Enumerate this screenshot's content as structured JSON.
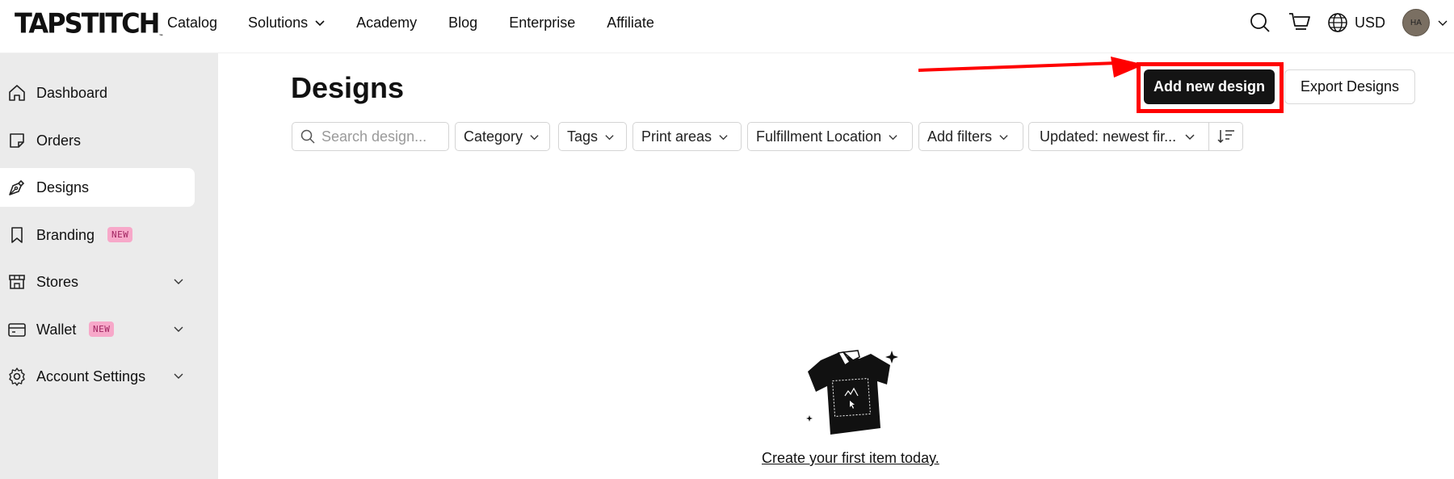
{
  "brand": {
    "logo_text": "TAPSTITCH",
    "logo_tm": "™"
  },
  "topnav": {
    "links": [
      {
        "label": "Catalog"
      },
      {
        "label": "Solutions"
      },
      {
        "label": "Academy"
      },
      {
        "label": "Blog"
      },
      {
        "label": "Enterprise"
      },
      {
        "label": "Affiliate"
      }
    ],
    "currency": "USD",
    "avatar_initials": "HA",
    "icons": [
      "search-icon",
      "cart-icon",
      "globe-icon",
      "chevron-down-icon"
    ]
  },
  "sidebar": {
    "items": [
      {
        "label": "Dashboard",
        "icon": "home-icon"
      },
      {
        "label": "Orders",
        "icon": "sticky-note-icon"
      },
      {
        "label": "Designs",
        "icon": "pen-nib-icon",
        "active": true
      },
      {
        "label": "Branding",
        "icon": "bookmark-icon",
        "badge": "NEW"
      },
      {
        "label": "Stores",
        "icon": "store-icon"
      },
      {
        "label": "Wallet",
        "icon": "wallet-icon",
        "badge": "NEW"
      },
      {
        "label": "Account Settings",
        "icon": "gear-icon"
      }
    ]
  },
  "main": {
    "title": "Designs",
    "add_button": "Add new design",
    "export_button": "Export Designs",
    "search_placeholder": "Search design...",
    "filters": [
      {
        "label": "Category"
      },
      {
        "label": "Tags"
      },
      {
        "label": "Print areas"
      },
      {
        "label": "Fulfillment Location"
      },
      {
        "label": "Add filters"
      }
    ],
    "sort_label": "Updated: newest fir...",
    "empty_link": "Create your first item today."
  },
  "colors": {
    "primary_button": "#141414",
    "sidebar_bg": "#ebebeb",
    "badge_bg": "#f7a8c9",
    "highlight": "#ff0000"
  }
}
